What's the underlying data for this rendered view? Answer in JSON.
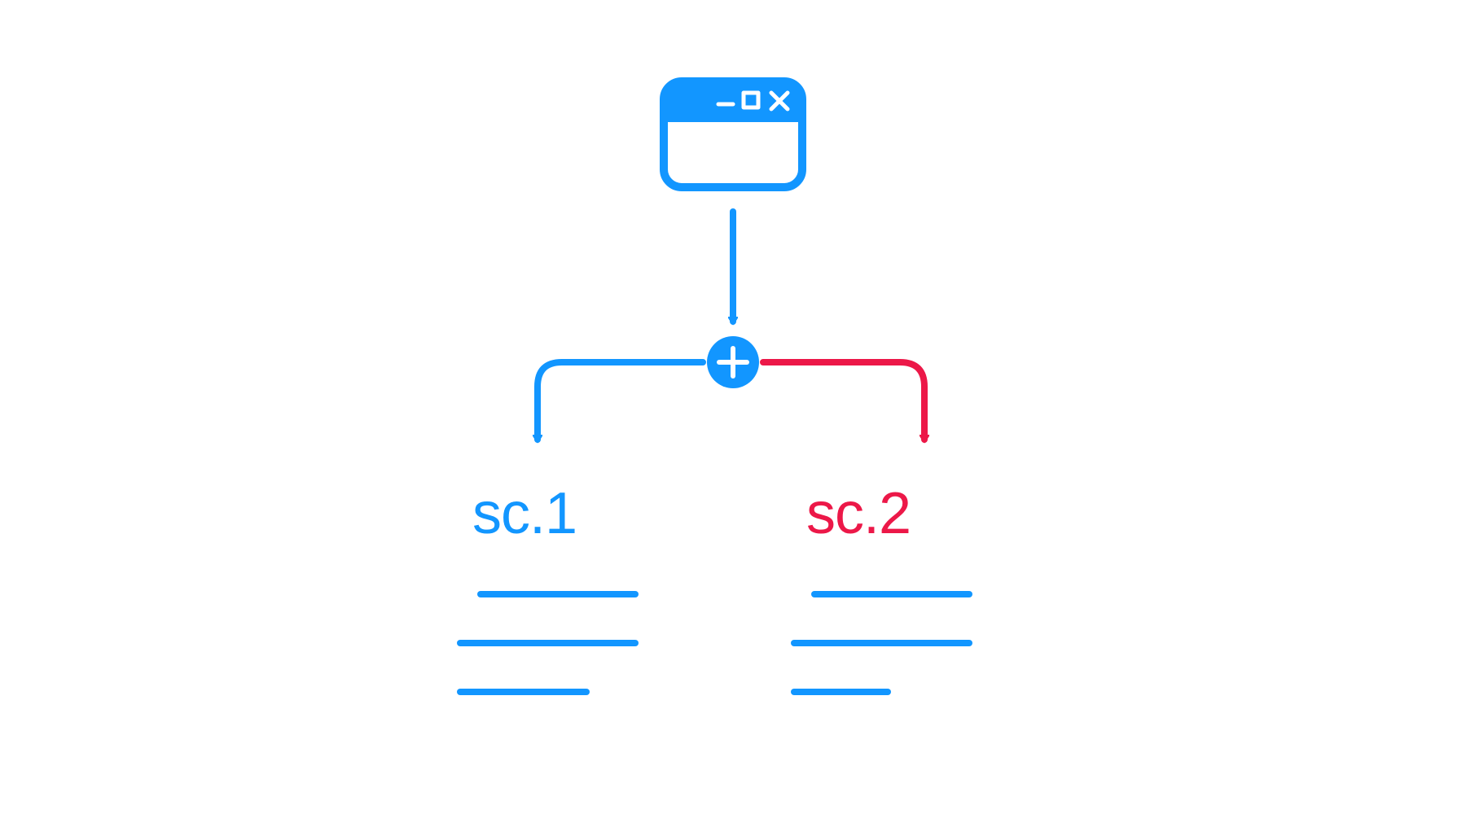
{
  "diagram": {
    "root_node": "window",
    "split_node": "plus",
    "branches": {
      "left": {
        "label": "sc.1",
        "color": "#1296FF"
      },
      "right": {
        "label": "sc.2",
        "color": "#EC1848"
      }
    },
    "colors": {
      "primary_blue": "#1296FF",
      "accent_red": "#EC1848",
      "white": "#FFFFFF"
    }
  }
}
